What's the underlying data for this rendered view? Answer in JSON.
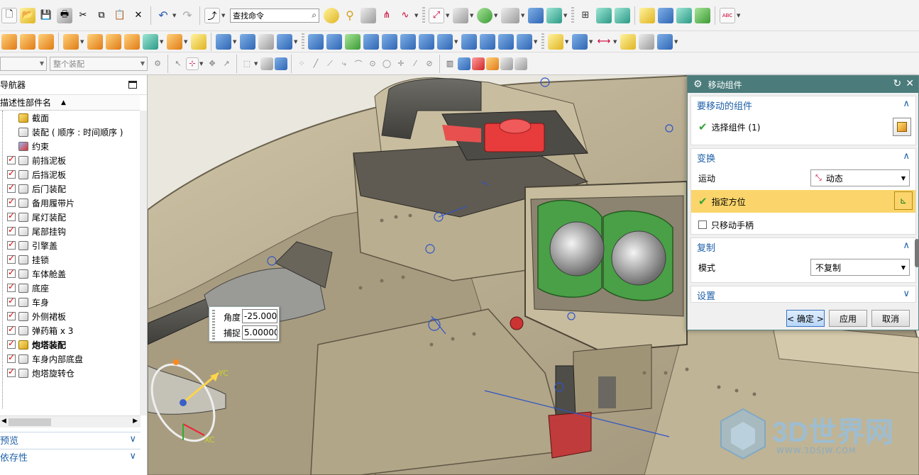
{
  "toolbar": {
    "search_placeholder": "查找命令",
    "assembly_filter": "",
    "assembly_scope": "整个装配"
  },
  "navigator": {
    "title": "导航器",
    "column_header": "描述性部件名",
    "sections": [
      {
        "label": "预览"
      },
      {
        "label": "依存性"
      }
    ],
    "items": [
      {
        "label": "截面",
        "checked": false,
        "kind": "folder",
        "bold": false
      },
      {
        "label": "装配 ( 顺序 : 时间顺序 )",
        "checked": false,
        "kind": "assembly-order",
        "bold": false
      },
      {
        "label": "约束",
        "checked": false,
        "kind": "constraint",
        "bold": false
      },
      {
        "label": "前挡泥板",
        "checked": true,
        "kind": "part",
        "bold": false
      },
      {
        "label": "后挡泥板",
        "checked": true,
        "kind": "part",
        "bold": false
      },
      {
        "label": "后门装配",
        "checked": true,
        "kind": "part",
        "bold": false
      },
      {
        "label": "备用履带片",
        "checked": true,
        "kind": "part",
        "bold": false
      },
      {
        "label": "尾灯装配",
        "checked": true,
        "kind": "part",
        "bold": false
      },
      {
        "label": "尾部挂钩",
        "checked": true,
        "kind": "part",
        "bold": false
      },
      {
        "label": "引擎盖",
        "checked": true,
        "kind": "part",
        "bold": false
      },
      {
        "label": "挂锁",
        "checked": true,
        "kind": "part",
        "bold": false
      },
      {
        "label": "车体舱盖",
        "checked": true,
        "kind": "part",
        "bold": false
      },
      {
        "label": "底座",
        "checked": true,
        "kind": "part",
        "bold": false
      },
      {
        "label": "车身",
        "checked": true,
        "kind": "part",
        "bold": false
      },
      {
        "label": "外侧裙板",
        "checked": true,
        "kind": "part",
        "bold": false
      },
      {
        "label": "弹药箱 x 3",
        "checked": true,
        "kind": "part",
        "bold": false
      },
      {
        "label": "炮塔装配",
        "checked": true,
        "kind": "assembly",
        "bold": true
      },
      {
        "label": "车身内部底盘",
        "checked": true,
        "kind": "part",
        "bold": false
      },
      {
        "label": "炮塔旋转仓",
        "checked": true,
        "kind": "part",
        "bold": false
      }
    ]
  },
  "float_input": {
    "angle_label": "角度",
    "angle_value": "-25.000",
    "snap_label": "捕捉",
    "snap_value": "5.00000"
  },
  "triad": {
    "yc": "YC",
    "xc": "XC"
  },
  "dialog": {
    "title": "移动组件",
    "group_components": {
      "title": "要移动的组件",
      "select_label": "选择组件 (1)"
    },
    "group_transform": {
      "title": "变换",
      "motion_label": "运动",
      "motion_value": "动态",
      "orient_label": "指定方位",
      "handle_only_label": "只移动手柄"
    },
    "group_copy": {
      "title": "复制",
      "mode_label": "模式",
      "mode_value": "不复制"
    },
    "group_settings": {
      "title": "设置"
    },
    "ok_label": "< 确定 >",
    "apply_label": "应用",
    "cancel_label": "取消"
  },
  "watermark": {
    "text": "3D世界网",
    "url": "WWW.3DSJW.COM"
  },
  "colors": {
    "dialog_title_bg": "#4b7b7b",
    "section_title": "#1d5fa8",
    "highlight": "#fbd56b",
    "model_body": "#b9ad8f",
    "model_red": "#e83b3b",
    "model_green": "#49a046"
  }
}
